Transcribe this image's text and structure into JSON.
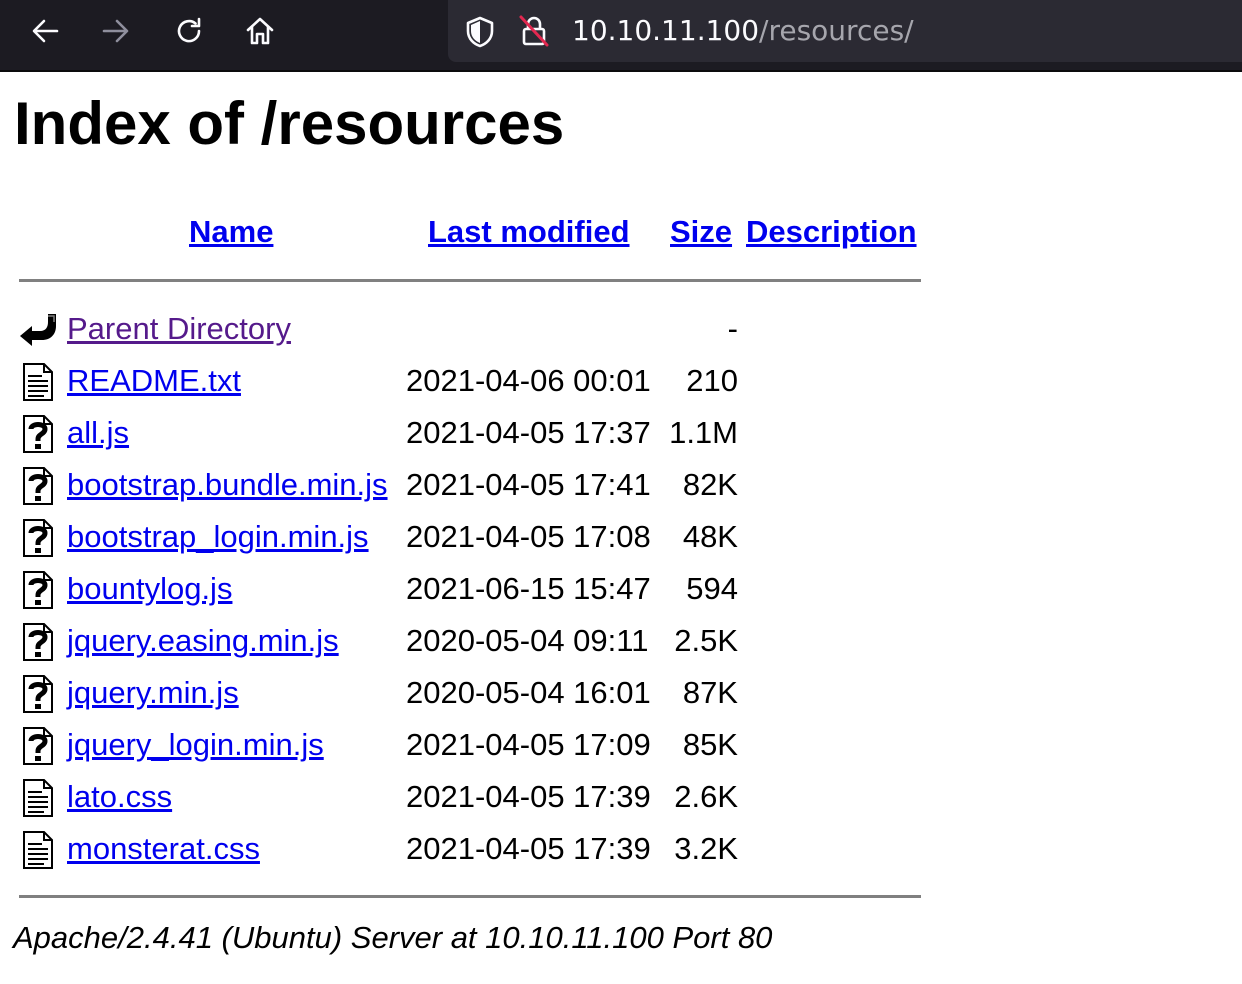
{
  "browser": {
    "url_host": "10.10.11.100",
    "url_path": "/resources/"
  },
  "page": {
    "title": "Index of /resources",
    "columns": {
      "name": "Name",
      "last_modified": "Last modified",
      "size": "Size",
      "description": "Description"
    },
    "parent": {
      "label": "Parent Directory",
      "size": "-",
      "icon": "back-arrow-icon"
    },
    "rows": [
      {
        "name": "README.txt",
        "date": "2021-04-06 00:01",
        "size": "210",
        "icon": "text-file-icon"
      },
      {
        "name": "all.js",
        "date": "2021-04-05 17:37",
        "size": "1.1M",
        "icon": "unknown-file-icon"
      },
      {
        "name": "bootstrap.bundle.min.js",
        "date": "2021-04-05 17:41",
        "size": "82K",
        "icon": "unknown-file-icon"
      },
      {
        "name": "bootstrap_login.min.js",
        "date": "2021-04-05 17:08",
        "size": "48K",
        "icon": "unknown-file-icon"
      },
      {
        "name": "bountylog.js",
        "date": "2021-06-15 15:47",
        "size": "594",
        "icon": "unknown-file-icon"
      },
      {
        "name": "jquery.easing.min.js",
        "date": "2020-05-04 09:11",
        "size": "2.5K",
        "icon": "unknown-file-icon"
      },
      {
        "name": "jquery.min.js",
        "date": "2020-05-04 16:01",
        "size": "87K",
        "icon": "unknown-file-icon"
      },
      {
        "name": "jquery_login.min.js",
        "date": "2021-04-05 17:09",
        "size": "85K",
        "icon": "unknown-file-icon"
      },
      {
        "name": "lato.css",
        "date": "2021-04-05 17:39",
        "size": "2.6K",
        "icon": "text-file-icon"
      },
      {
        "name": "monsterat.css",
        "date": "2021-04-05 17:39",
        "size": "3.2K",
        "icon": "text-file-icon"
      }
    ],
    "address": "Apache/2.4.41 (Ubuntu) Server at 10.10.11.100 Port 80"
  },
  "colors": {
    "toolbar_bg": "#1c1b22",
    "urlbar_bg": "#2b2a33",
    "link": "#0000ee",
    "visited_link": "#551a8b"
  }
}
